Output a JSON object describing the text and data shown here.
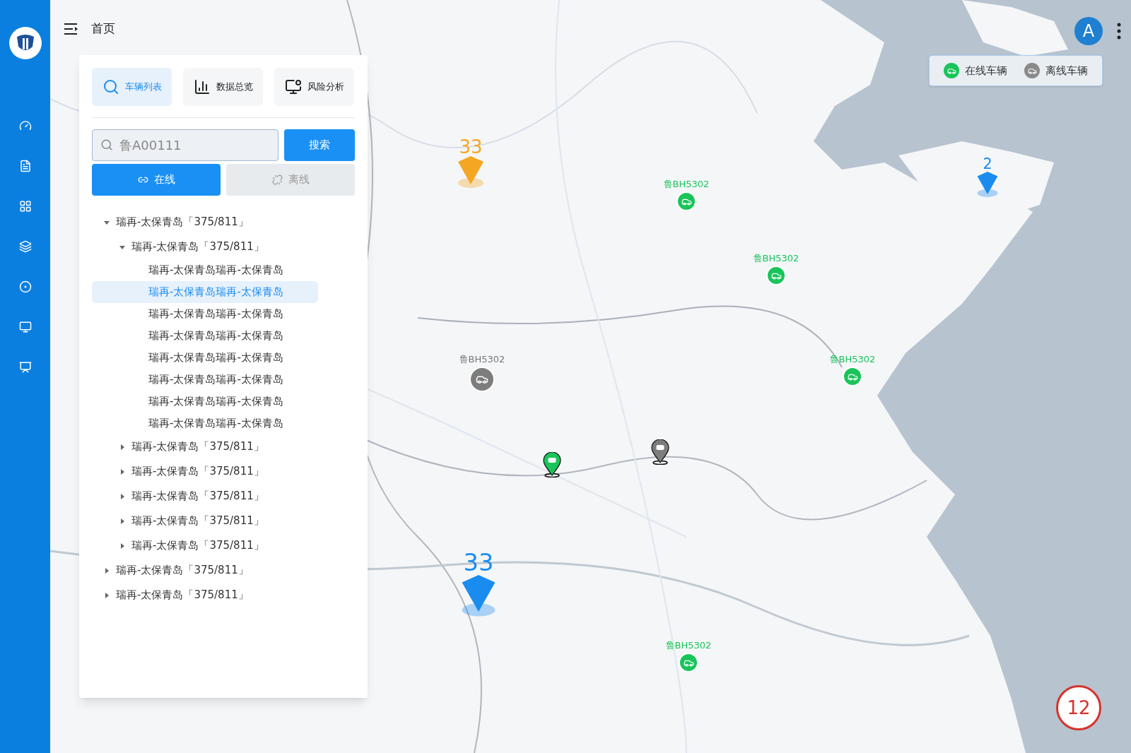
{
  "header": {
    "title": "首页"
  },
  "user": {
    "avatar": "A"
  },
  "legend": [
    {
      "label": "在线车辆",
      "color": "#19c45a"
    },
    {
      "label": "离线车辆",
      "color": "#8a8a8a"
    }
  ],
  "panel": {
    "tabs": [
      {
        "label": "车辆列表",
        "selected": true
      },
      {
        "label": "数据总览",
        "selected": false
      },
      {
        "label": "风险分析",
        "selected": false
      }
    ],
    "search": {
      "placeholder": "鲁A00111",
      "button": "搜索"
    },
    "filters": [
      {
        "label": "在线",
        "selected": true
      },
      {
        "label": "离线",
        "selected": false
      }
    ],
    "tree": [
      {
        "label": "瑞再-太保青岛「375/811」",
        "expanded": true,
        "children": [
          {
            "label": "瑞再-太保青岛「375/811」",
            "expanded": true,
            "children": [
              {
                "label": "瑞再-太保青岛瑞再-太保青岛",
                "selected": false
              },
              {
                "label": "瑞再-太保青岛瑞再-太保青岛",
                "selected": true
              },
              {
                "label": "瑞再-太保青岛瑞再-太保青岛",
                "selected": false
              },
              {
                "label": "瑞再-太保青岛瑞再-太保青岛",
                "selected": false
              },
              {
                "label": "瑞再-太保青岛瑞再-太保青岛",
                "selected": false
              },
              {
                "label": "瑞再-太保青岛瑞再-太保青岛",
                "selected": false
              },
              {
                "label": "瑞再-太保青岛瑞再-太保青岛",
                "selected": false
              },
              {
                "label": "瑞再-太保青岛瑞再-太保青岛",
                "selected": false
              }
            ]
          },
          {
            "label": "瑞再-太保青岛「375/811」",
            "expanded": false
          },
          {
            "label": "瑞再-太保青岛「375/811」",
            "expanded": false
          },
          {
            "label": "瑞再-太保青岛「375/811」",
            "expanded": false
          },
          {
            "label": "瑞再-太保青岛「375/811」",
            "expanded": false
          },
          {
            "label": "瑞再-太保青岛「375/811」",
            "expanded": false
          }
        ]
      },
      {
        "label": "瑞再-太保青岛「375/811」",
        "expanded": false
      },
      {
        "label": "瑞再-太保青岛「375/811」",
        "expanded": false
      }
    ]
  },
  "markers": [
    {
      "kind": "cluster",
      "count": "33",
      "color": "#f5a623"
    },
    {
      "kind": "cluster",
      "count": "2",
      "color": "#1a8cf0"
    },
    {
      "kind": "cluster",
      "count": "33",
      "color": "#1a8cf0"
    },
    {
      "kind": "vehicle",
      "plate": "鲁BH5302",
      "online": true
    },
    {
      "kind": "vehicle",
      "plate": "鲁BH5302",
      "online": true
    },
    {
      "kind": "vehicle",
      "plate": "鲁BH5302",
      "online": true
    },
    {
      "kind": "vehicle",
      "plate": "鲁BH5302",
      "online": false
    },
    {
      "kind": "vehicle",
      "plate": "鲁BH5302",
      "online": true
    },
    {
      "kind": "pin",
      "online": true
    },
    {
      "kind": "pin",
      "online": false
    }
  ],
  "alarm_count": "12"
}
